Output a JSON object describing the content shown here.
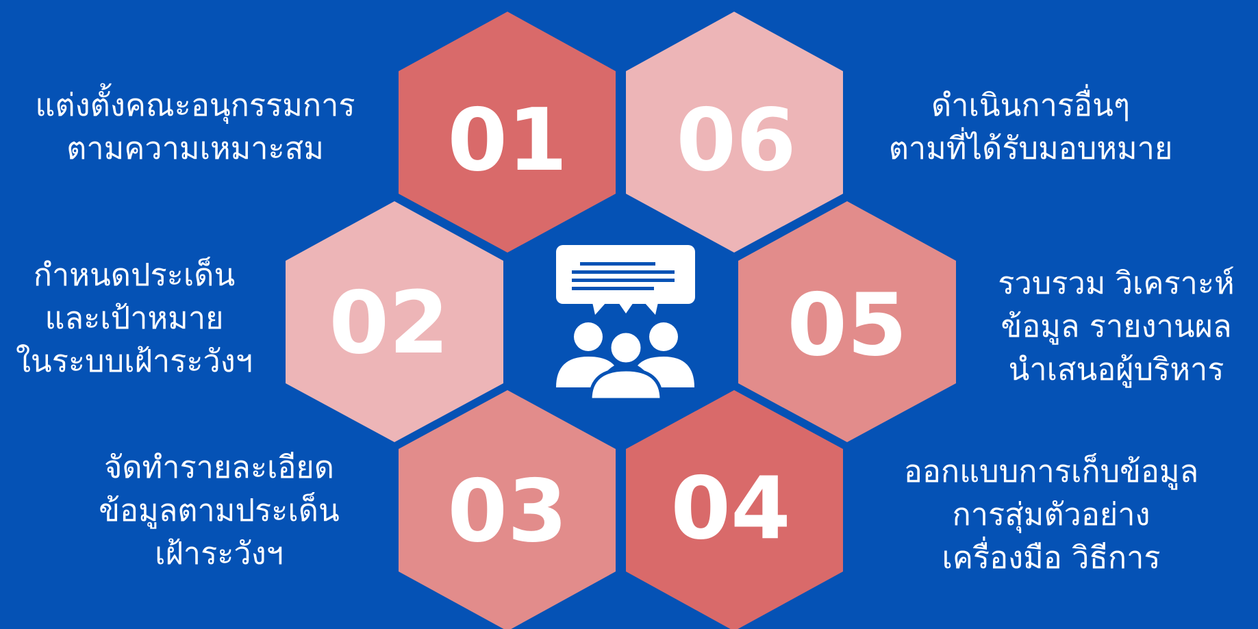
{
  "background_color": "#0552b5",
  "colors": {
    "dark": "#d96a6a",
    "medium": "#e28c8b",
    "light": "#edb5b7",
    "icon": "#ffffff",
    "text": "#ffffff"
  },
  "center_icon": "team-discussion-icon",
  "steps": [
    {
      "number": "01",
      "tone": "dark",
      "label_lines": [
        "แต่งตั้งคณะอนุกรรมการ",
        "ตามความเหมาะสม"
      ]
    },
    {
      "number": "02",
      "tone": "light",
      "label_lines": [
        "กำหนดประเด็น",
        "และเป้าหมาย",
        "ในระบบเฝ้าระวังฯ"
      ]
    },
    {
      "number": "03",
      "tone": "medium",
      "label_lines": [
        "จัดทำรายละเอียด",
        "ข้อมูลตามประเด็น",
        "เฝ้าระวังฯ"
      ]
    },
    {
      "number": "04",
      "tone": "dark",
      "label_lines": [
        "ออกแบบการเก็บข้อมูล",
        "การสุ่มตัวอย่าง",
        "เครื่องมือ วิธีการ"
      ]
    },
    {
      "number": "05",
      "tone": "medium",
      "label_lines": [
        "รวบรวม วิเคราะห์",
        "ข้อมูล รายงานผล",
        "นำเสนอผู้บริหาร"
      ]
    },
    {
      "number": "06",
      "tone": "light",
      "label_lines": [
        "ดำเนินการอื่นๆ",
        "ตามที่ได้รับมอบหมาย"
      ]
    }
  ]
}
